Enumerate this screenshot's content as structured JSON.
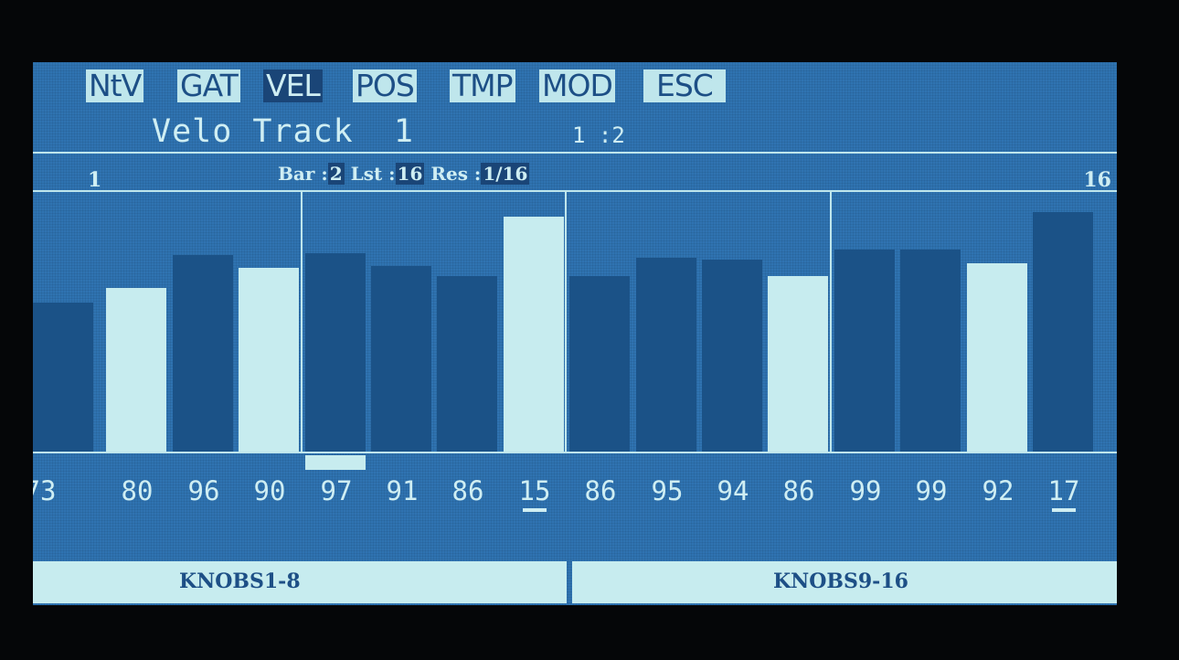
{
  "tabs": [
    {
      "label": "NtV",
      "active": false
    },
    {
      "label": "GAT",
      "active": false
    },
    {
      "label": "VEL",
      "active": true
    },
    {
      "label": "POS",
      "active": false
    },
    {
      "label": "TMP",
      "active": false
    },
    {
      "label": "MOD",
      "active": false
    },
    {
      "label": "ESC",
      "active": false
    }
  ],
  "header": {
    "title": "Velo Track  1",
    "position": "1 :2"
  },
  "ruler": {
    "start": "1",
    "end": "16",
    "bar_label": "Bar :",
    "bar_value": "2",
    "last_label": "Lst :",
    "last_value": "16",
    "res_label": "Res :",
    "res_value": "1/16"
  },
  "steps": [
    {
      "label": "73",
      "value": 73,
      "highlight": false
    },
    {
      "label": "80",
      "value": 80,
      "highlight": true
    },
    {
      "label": "96",
      "value": 96,
      "highlight": false
    },
    {
      "label": "90",
      "value": 90,
      "highlight": true
    },
    {
      "label": "97",
      "value": 97,
      "highlight": false
    },
    {
      "label": "91",
      "value": 91,
      "highlight": false
    },
    {
      "label": "86",
      "value": 86,
      "highlight": false
    },
    {
      "label": "15",
      "value": 115,
      "highlight": true,
      "underlined": true
    },
    {
      "label": "86",
      "value": 86,
      "highlight": false
    },
    {
      "label": "95",
      "value": 95,
      "highlight": false
    },
    {
      "label": "94",
      "value": 94,
      "highlight": false
    },
    {
      "label": "86",
      "value": 86,
      "highlight": true
    },
    {
      "label": "99",
      "value": 99,
      "highlight": false
    },
    {
      "label": "99",
      "value": 99,
      "highlight": false
    },
    {
      "label": "92",
      "value": 92,
      "highlight": true
    },
    {
      "label": "17",
      "value": 117,
      "highlight": false,
      "underlined": true
    }
  ],
  "cursor_step": 5,
  "footer": {
    "left": "KNOBS1-8",
    "right": "KNOBS9-16"
  },
  "colors": {
    "screen": "#2f73b1",
    "bar_dark": "#1b5287",
    "bar_light": "#c7ecef",
    "text": "#cfeef3"
  }
}
